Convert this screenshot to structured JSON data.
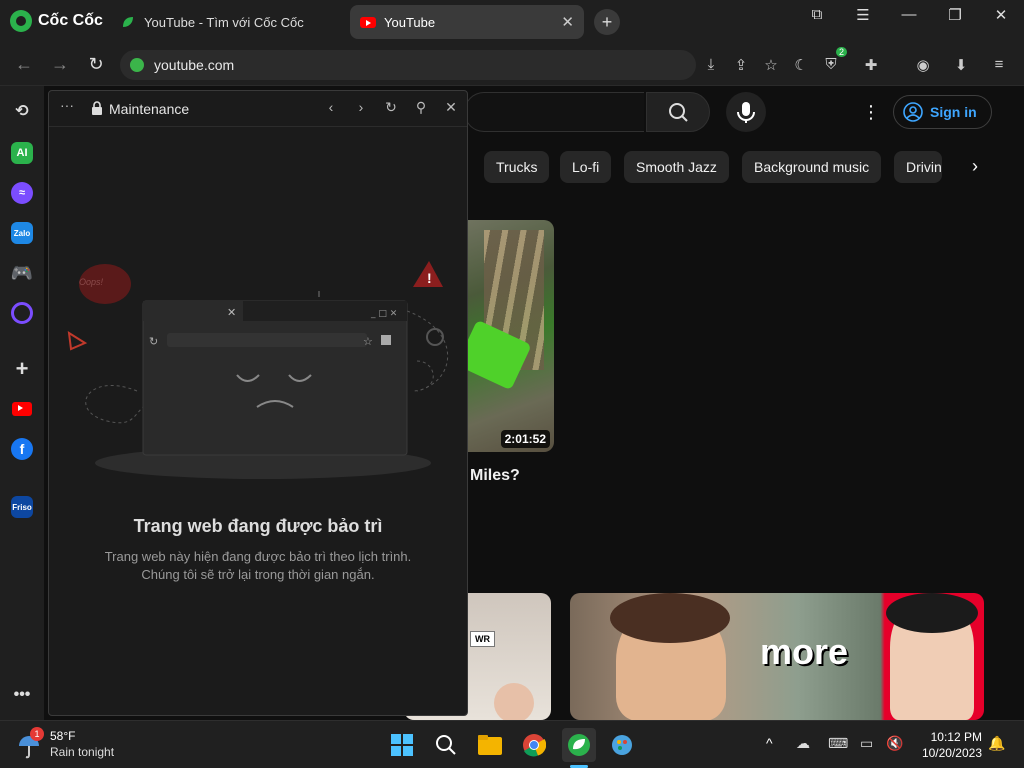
{
  "browser": {
    "brand": "Cốc Cốc",
    "tabs": [
      {
        "title": "YouTube - Tìm với Cốc Cốc",
        "active": false
      },
      {
        "title": "YouTube",
        "active": true
      }
    ],
    "address": "youtube.com",
    "shield_count": "2"
  },
  "panel": {
    "title": "Maintenance",
    "illustration_bubble": "Oops!",
    "heading": "Trang web đang được bảo trì",
    "desc_line1": "Trang web này hiện đang được bảo trì theo lịch trình.",
    "desc_line2": "Chúng tôi sẽ trở lại trong thời gian ngắn."
  },
  "youtube": {
    "sign_in": "Sign in",
    "chips": [
      "Trucks",
      "Lo-fi",
      "Smooth Jazz",
      "Background music",
      "Drivin"
    ],
    "video1": {
      "duration": "2:01:52",
      "title_fragment": "Miles?"
    },
    "video2": {
      "badge": "WR"
    },
    "video3": {
      "overlay_text": "more"
    }
  },
  "taskbar": {
    "weather_temp": "58°F",
    "weather_desc": "Rain tonight",
    "weather_badge": "1",
    "time": "10:12 PM",
    "date": "10/20/2023"
  },
  "colors": {
    "accent_green": "#2bb24c",
    "youtube_red": "#ff0000",
    "link_blue": "#3ea6ff"
  }
}
